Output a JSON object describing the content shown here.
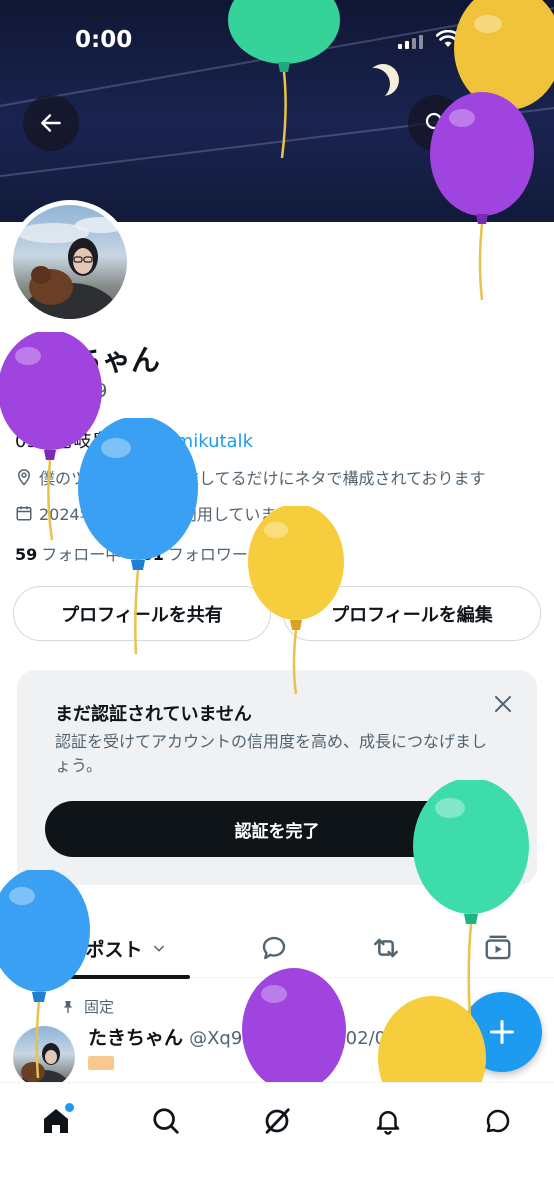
{
  "status_bar": {
    "time": "0:00"
  },
  "profile": {
    "name": "たきちゃん",
    "handle": "@Xq9469",
    "bio_prefix": "03 | 壱岐島 | ♂ | ",
    "bio_hashtag": "#mikutalk",
    "location": "僕のツイートは金村推してるだけにネタで構成されております",
    "joined": "2024年7月からXを利用しています",
    "following_count": "59",
    "following_label": "フォロー中",
    "followers_count": "61",
    "followers_label": "フォロワー"
  },
  "buttons": {
    "share_profile": "プロフィールを共有",
    "edit_profile": "プロフィールを編集"
  },
  "verification_card": {
    "title": "まだ認証されていません",
    "body": "認証を受けてアカウントの信用度を高め、成長につなげましょう。",
    "button": "認証を完了"
  },
  "tabs": {
    "posts": "ポスト"
  },
  "pinned_post": {
    "pinned_label": "固定",
    "author": "たきちゃん",
    "meta": "@Xq9469 · 2026/02/05"
  },
  "icons": {
    "back": "arrow-left-icon",
    "search": "search-icon",
    "location": "location-pin-icon",
    "calendar": "calendar-icon",
    "close": "close-icon",
    "reply": "speech-bubble-icon",
    "repost": "repost-icon",
    "media": "video-icon",
    "home": "home-icon",
    "explore": "search-icon",
    "grok": "slash-circle-icon",
    "notifications": "bell-icon",
    "messages": "message-icon",
    "compose": "plus-icon",
    "pin": "pin-icon"
  },
  "colors": {
    "accent": "#1d9bf0",
    "text": "#0f1419",
    "muted": "#536471"
  }
}
